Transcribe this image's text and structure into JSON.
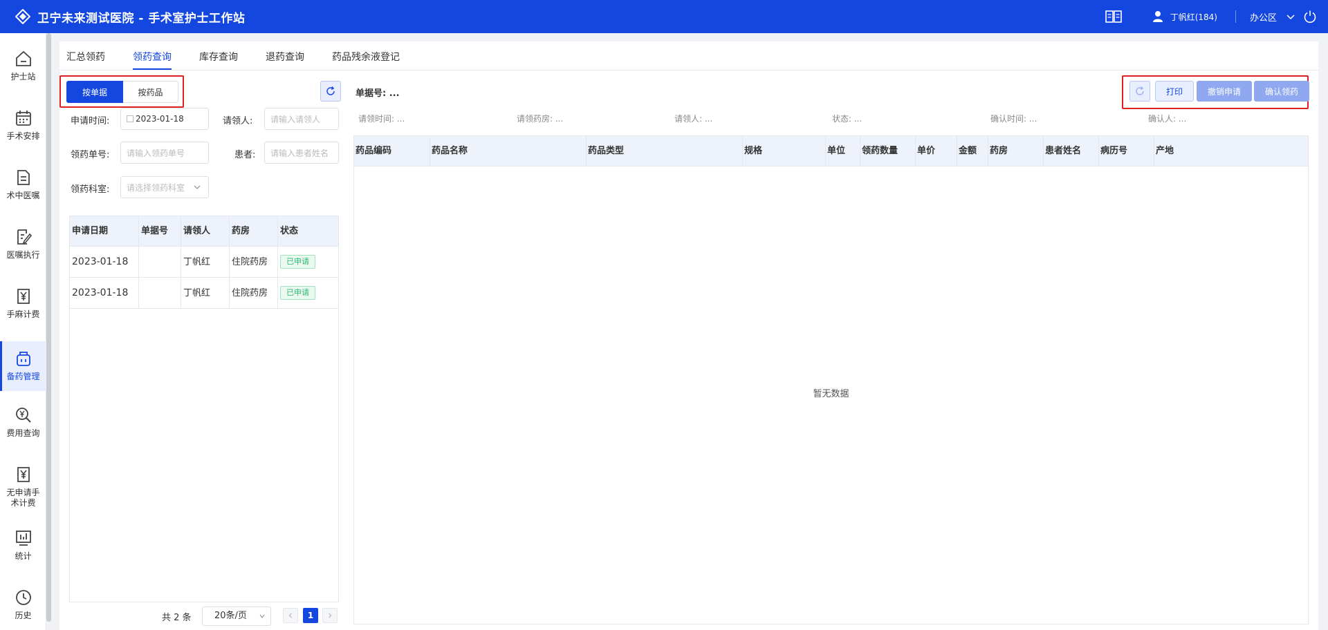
{
  "header": {
    "title": "卫宁未来测试医院 - 手术室护士工作站",
    "username": "丁帆红(184)",
    "office": "办公区",
    "brand_color": "#1347e0"
  },
  "sidebar": {
    "items": [
      {
        "label": "护士站",
        "icon": "home-icon"
      },
      {
        "label": "手术安排",
        "icon": "calendar-icon"
      },
      {
        "label": "术中医嘱",
        "icon": "document-icon"
      },
      {
        "label": "医嘱执行",
        "icon": "edit-document-icon"
      },
      {
        "label": "手麻计费",
        "icon": "yen-document-icon"
      },
      {
        "label": "备药管理",
        "icon": "medicine-icon",
        "active": true
      },
      {
        "label": "费用查询",
        "icon": "yen-search-icon"
      },
      {
        "label": "无申请手术计费",
        "icon": "yen-document-icon"
      },
      {
        "label": "统计",
        "icon": "chart-icon"
      },
      {
        "label": "历史",
        "icon": "clock-icon"
      }
    ]
  },
  "tabs": [
    {
      "label": "汇总领药"
    },
    {
      "label": "领药查询",
      "active": true
    },
    {
      "label": "库存查询"
    },
    {
      "label": "退药查询"
    },
    {
      "label": "药品残余液登记"
    }
  ],
  "left": {
    "segment": {
      "by_document": "按单据",
      "by_drug": "按药品"
    },
    "filters": {
      "apply_time_label": "申请时间:",
      "apply_time_value": "2023-01-18",
      "requester_label": "请领人:",
      "requester_placeholder": "请输入请领人",
      "order_no_label": "领药单号:",
      "order_no_placeholder": "请输入领药单号",
      "patient_label": "患者:",
      "patient_placeholder": "请输入患者姓名",
      "dept_label": "领药科室:",
      "dept_placeholder": "请选择领药科室"
    },
    "table": {
      "columns": [
        "申请日期",
        "单据号",
        "请领人",
        "药房",
        "状态"
      ],
      "rows": [
        {
          "date": "2023-01-18",
          "doc_no": "",
          "requester": "丁帆红",
          "pharmacy": "住院药房",
          "status": "已申请"
        },
        {
          "date": "2023-01-18",
          "doc_no": "",
          "requester": "丁帆红",
          "pharmacy": "住院药房",
          "status": "已申请"
        }
      ]
    },
    "pagination": {
      "total": "共 2 条",
      "page_size": "20条/页",
      "current_page": "1"
    }
  },
  "right": {
    "doc_no": "单据号: ...",
    "meta": {
      "request_time": "请领时间: ...",
      "pharmacy": "请领药房: ...",
      "requester": "请领人: ...",
      "status": "状态: ...",
      "confirm_time": "确认时间: ...",
      "confirmer": "确认人: ..."
    },
    "buttons": {
      "print": "打印",
      "cancel_request": "撤销申请",
      "confirm": "确认领药"
    },
    "table": {
      "columns": [
        "药品编码",
        "药品名称",
        "药品类型",
        "规格",
        "单位",
        "领药数量",
        "单价",
        "金额",
        "药房",
        "患者姓名",
        "病历号",
        "产地"
      ],
      "empty_text": "暂无数据"
    }
  }
}
